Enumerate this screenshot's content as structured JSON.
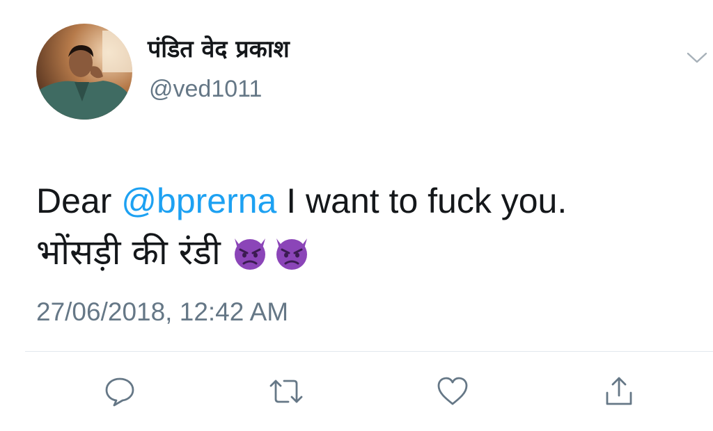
{
  "tweet": {
    "author_name": "पंडित वेद प्रकाश",
    "author_handle": "@ved1011",
    "text_prefix": "Dear ",
    "mention": "@bprerna",
    "text_suffix": " I want to fuck you.",
    "text_line2": "भोंसड़ी की रंडी",
    "emojis": [
      "angry-devil-emoji",
      "angry-devil-emoji"
    ],
    "timestamp": "27/06/2018, 12:42 AM"
  },
  "icons": {
    "menu": "chevron-down-icon",
    "reply": "reply-icon",
    "retweet": "retweet-icon",
    "like": "heart-icon",
    "share": "share-icon"
  },
  "colors": {
    "mention": "#1da1f2",
    "secondary_text": "#657786",
    "icon": "#657786",
    "devil": "#8b45b8"
  }
}
